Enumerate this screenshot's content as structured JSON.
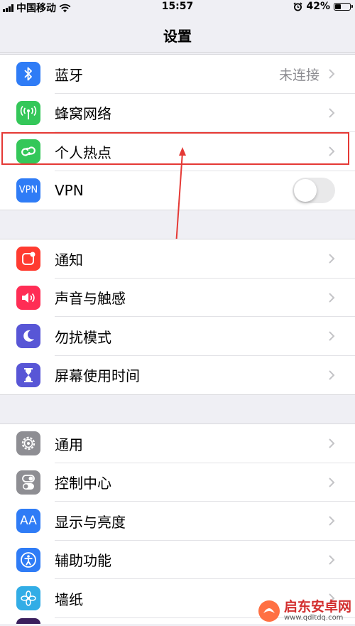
{
  "status": {
    "carrier": "中国移动",
    "time": "15:57",
    "battery_text": "42%",
    "battery_level": 0.42
  },
  "nav": {
    "title": "设置"
  },
  "group1": {
    "items": [
      {
        "label": "蓝牙",
        "icon": "bluetooth-icon",
        "color": "#2f7cf6",
        "value": "未连接"
      },
      {
        "label": "蜂窝网络",
        "icon": "cellular-antenna-icon",
        "color": "#34c759"
      },
      {
        "label": "个人热点",
        "icon": "hotspot-chain-icon",
        "color": "#34c759"
      },
      {
        "label": "VPN",
        "icon": "vpn-icon",
        "color": "#2f7cf6",
        "icon_text": "VPN",
        "toggle": false
      }
    ]
  },
  "group2": {
    "items": [
      {
        "label": "通知",
        "icon": "notifications-icon",
        "color": "#ff3b30"
      },
      {
        "label": "声音与触感",
        "icon": "speaker-icon",
        "color": "#ff2d55"
      },
      {
        "label": "勿扰模式",
        "icon": "moon-icon",
        "color": "#5856d6"
      },
      {
        "label": "屏幕使用时间",
        "icon": "hourglass-icon",
        "color": "#5856d6"
      }
    ]
  },
  "group3": {
    "items": [
      {
        "label": "通用",
        "icon": "gear-icon",
        "color": "#8e8e93"
      },
      {
        "label": "控制中心",
        "icon": "toggles-icon",
        "color": "#8e8e93"
      },
      {
        "label": "显示与亮度",
        "icon": "display-aa-icon",
        "color": "#2f7cf6",
        "icon_text": "AA"
      },
      {
        "label": "辅助功能",
        "icon": "accessibility-icon",
        "color": "#2f7cf6"
      },
      {
        "label": "墙纸",
        "icon": "flower-icon",
        "color": "#32ade6"
      }
    ]
  },
  "watermark": {
    "name": "启东安卓网",
    "url": "www.qdltdq.com"
  },
  "colors": {
    "annotation": "#e53935",
    "chevron": "#c4c4c7"
  }
}
